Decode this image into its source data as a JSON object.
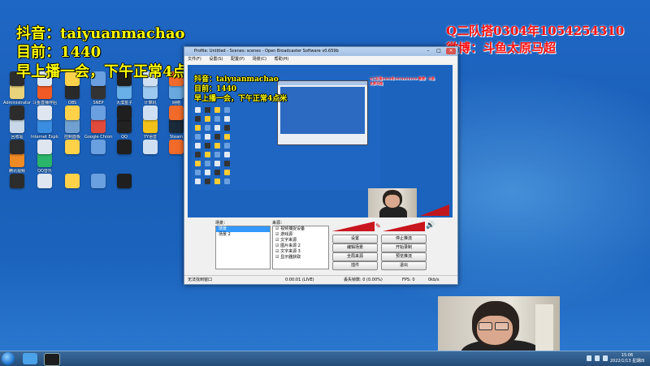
{
  "overlay": {
    "douyin_id": "抖音：taiyuanmachao",
    "count": "目前：1440",
    "schedule": "早上播一会，下午正常4点米",
    "qq_group": "Q二队搭0304年1054254310",
    "weibo": "微博：斗鱼太原马超"
  },
  "obs": {
    "title": "Profile: Untitled - Scenes: scenes - Open Broadcaster Software v0.659b",
    "menus": [
      "文件(F)",
      "设置(S)",
      "配置(P)",
      "场景(C)",
      "帮助(H)"
    ],
    "preview_overlay": {
      "line1": "抖音：taiyuanmachao",
      "line2": "目前：1440",
      "line3": "早上播一会，下午正常4点米"
    },
    "inner_red_text": "Q二队搭0304年1054254310 微博：斗鱼太原马超",
    "scenes_label": "场景：",
    "scenes": [
      {
        "label": "场景",
        "selected": true
      },
      {
        "label": "场景 2",
        "selected": false
      }
    ],
    "sources_label": "来源：",
    "sources": [
      "视频捕捉设备",
      "游戏源",
      "文字来源",
      "图片来源 2",
      "文字来源 3",
      "显示器获取"
    ],
    "buttons": {
      "settings": "设置",
      "start_stream": "停止推流",
      "edit_scene": "编辑场景",
      "start_record": "开始录制",
      "global_sources": "全局来源",
      "preview": "预览推流",
      "plugins": "插件",
      "exit": "退出"
    },
    "status": {
      "message": "无法找到窗口",
      "time": "0:00:01 (LIVE)",
      "dropped": "丢失帧数: 0 (0.00%)",
      "fps": "FPS: 0",
      "bitrate": "0kb/s"
    }
  },
  "desktop_icons": [
    {
      "label": "Administrator",
      "color": "#e8d27a"
    },
    {
      "label": "斗鱼直播伴侣",
      "color": "#f15a24"
    },
    {
      "label": "OBS",
      "color": "#2a2a2a"
    },
    {
      "label": "SNEP",
      "color": "#333333"
    },
    {
      "label": "大漠盒子",
      "color": "#6ab0e8"
    },
    {
      "label": "计算机",
      "color": "#9cc9f0"
    },
    {
      "label": "网络",
      "color": "#6aa8e0"
    },
    {
      "label": "回收站",
      "color": "#c8d8e8"
    },
    {
      "label": "Internet Explorer",
      "color": "#3a8de0"
    },
    {
      "label": "控制面板",
      "color": "#70a0d0"
    },
    {
      "label": "Google Chrome",
      "color": "#e04a3a"
    },
    {
      "label": "QQ",
      "color": "#222222"
    },
    {
      "label": "YY语音",
      "color": "#f2c21a"
    },
    {
      "label": "Steam",
      "color": "#1a2a3a"
    },
    {
      "label": "腾讯视频",
      "color": "#f08a24"
    },
    {
      "label": "QQ音乐",
      "color": "#2ab56a"
    }
  ],
  "taskbar": {
    "time": "15:06",
    "date": "2022/1/13 星期四"
  }
}
